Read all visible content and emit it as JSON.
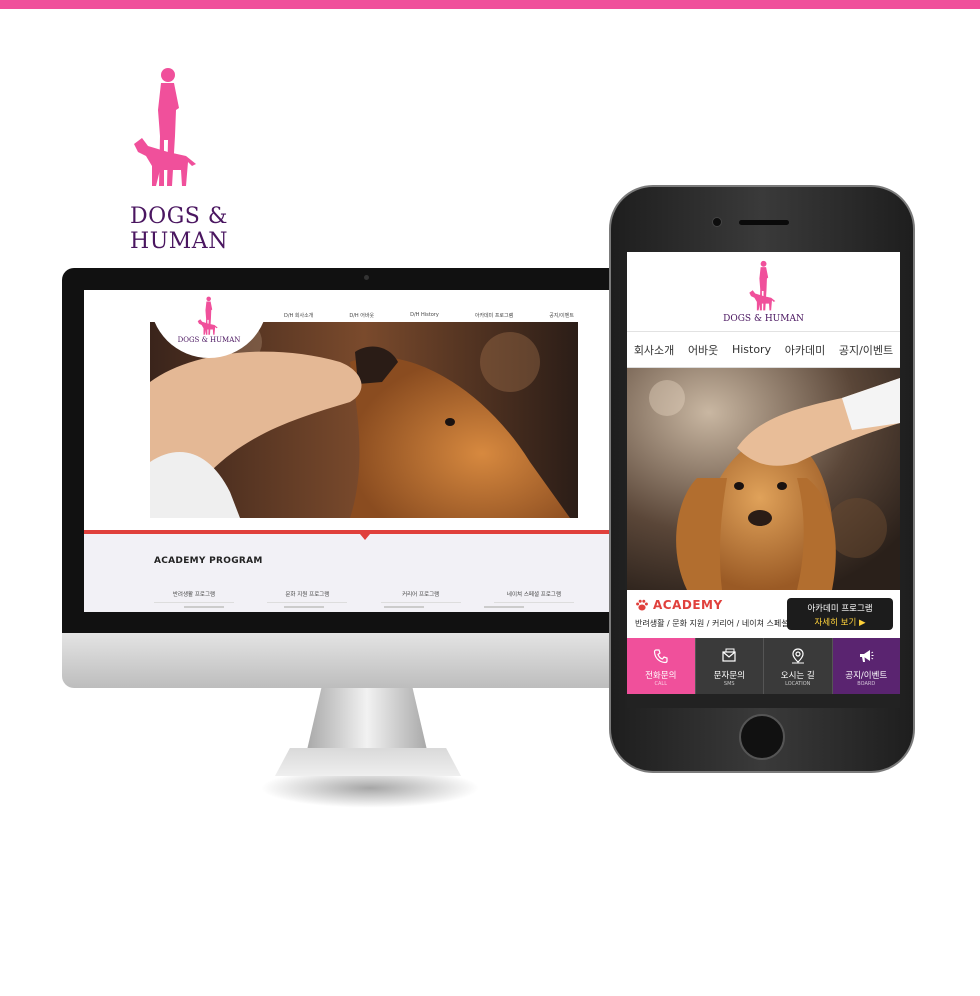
{
  "colors": {
    "brand_pink": "#f0509b",
    "brand_purple": "#4a1660",
    "accent_red": "#e0403c",
    "button_yellow": "#ffd23a"
  },
  "brand": {
    "name": "DOGS & HUMAN"
  },
  "desktop": {
    "logo_name": "DOGS & HUMAN",
    "nav": [
      "D/H 회사소개",
      "D/H 어바웃",
      "D/H History",
      "아카데미 프로그램",
      "공지/이벤트"
    ],
    "academy_title": "ACADEMY PROGRAM",
    "programs": [
      "반려생활 프로그램",
      "문화 지원 프로그램",
      "커리어 프로그램",
      "네이쳐 스페셜 프로그램"
    ]
  },
  "mobile": {
    "logo_name": "DOGS & HUMAN",
    "nav": [
      "회사소개",
      "어바웃",
      "History",
      "아카데미",
      "공지/이벤트"
    ],
    "academy": {
      "title": "ACADEMY",
      "subtitle": "반려생활 / 문화 지원 / 커리어 / 네이쳐 스페셜",
      "button_line1": "아카데미 프로그램",
      "button_line2": "자세히 보기 ▶"
    },
    "quick": [
      {
        "label": "전화문의",
        "sub": "CALL",
        "icon": "phone-icon",
        "color": "#f0509b"
      },
      {
        "label": "문자문의",
        "sub": "SMS",
        "icon": "message-icon",
        "color": "#3a3a3a"
      },
      {
        "label": "오시는 길",
        "sub": "LOCATION",
        "icon": "location-icon",
        "color": "#3a3a3a"
      },
      {
        "label": "공지/이벤트",
        "sub": "BOARD",
        "icon": "megaphone-icon",
        "color": "#5a2470"
      }
    ]
  }
}
